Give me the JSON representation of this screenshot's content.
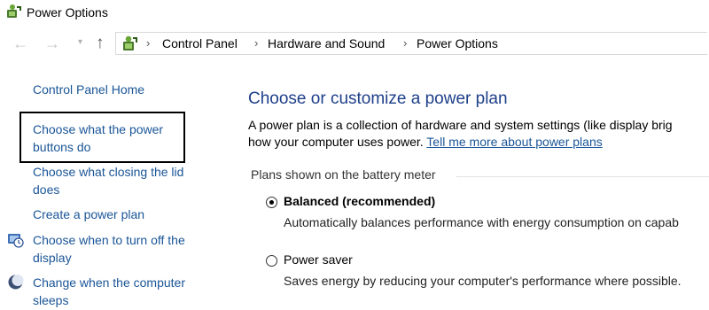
{
  "window": {
    "title": "Power Options",
    "icon": "power-options-icon"
  },
  "address_bar": {
    "back_icon": "back-arrow-icon",
    "forward_icon": "forward-arrow-icon",
    "up_icon": "up-arrow-icon",
    "breadcrumb": [
      "Control Panel",
      "Hardware and Sound",
      "Power Options"
    ]
  },
  "sidebar": {
    "items": [
      {
        "label": "Control Panel Home"
      },
      {
        "label": "Choose what the power buttons do",
        "lines": [
          "Choose what the power",
          "buttons do"
        ],
        "highlighted": true
      },
      {
        "label": "Choose what closing the lid does",
        "lines": [
          "Choose what closing the lid",
          "does"
        ]
      },
      {
        "label": "Create a power plan"
      },
      {
        "label": "Choose when to turn off the display",
        "lines": [
          "Choose when to turn off the",
          "display"
        ],
        "icon": "display-schedule-icon"
      },
      {
        "label": "Change when the computer sleeps",
        "lines": [
          "Change when the computer",
          "sleeps"
        ],
        "icon": "sleep-moon-icon"
      }
    ]
  },
  "main": {
    "heading": "Choose or customize a power plan",
    "intro_line1": "A power plan is a collection of hardware and system settings (like display brig",
    "intro_line2": "how your computer uses power. ",
    "intro_link": "Tell me more about power plans",
    "plans_header": "Plans shown on the battery meter",
    "plans": [
      {
        "name": "Balanced (recommended)",
        "description": "Automatically balances performance with energy consumption on capab",
        "selected": true
      },
      {
        "name": "Power saver",
        "description": "Saves energy by reducing your computer's performance where possible.",
        "selected": false
      }
    ]
  },
  "colors": {
    "link": "#1a5597",
    "heading": "#1e3f8a",
    "highlight_border": "#000000"
  }
}
